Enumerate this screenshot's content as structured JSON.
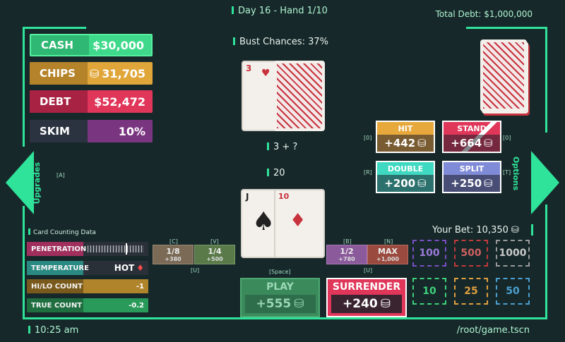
{
  "hud": {
    "day_hand": "Day 16  -  Hand 1/10",
    "total_debt": "Total Debt: $1,000,000",
    "clock": "10:25 am",
    "file_path": "/root/game.tscn"
  },
  "stats": {
    "cash": {
      "label": "CASH",
      "value": "$30,000",
      "color": "#3ed98a"
    },
    "chips": {
      "label": "CHIPS",
      "value": "31,705",
      "color": "#e0a63a"
    },
    "debt": {
      "label": "DEBT",
      "value": "$52,472",
      "color": "#e0365a"
    },
    "skim": {
      "label": "SKIM",
      "value": "10%",
      "color": "#8a3a8e"
    }
  },
  "table": {
    "bust_chances": "Bust Chances: 37%",
    "dealer_total": "3 + ?",
    "player_total": "20",
    "dealer_card": {
      "rank": "3",
      "suit": "♥"
    },
    "player_cards": [
      {
        "rank": "J",
        "suit": "♠"
      },
      {
        "rank": "10",
        "suit": "♦"
      }
    ]
  },
  "side": {
    "upgrades": "Upgrades",
    "upgrades_key": "[A]",
    "options": "Options",
    "options_key": "[T]"
  },
  "actions": {
    "hit": {
      "label": "HIT",
      "value": "+442",
      "key": "[0]",
      "color": "#e8a93c"
    },
    "stand": {
      "label": "STAND",
      "value": "+664",
      "key": "[0]",
      "color": "#e0365a"
    },
    "double": {
      "label": "DOUBLE",
      "value": "+200",
      "key": "[R]",
      "color": "#3fd8c0"
    },
    "split": {
      "label": "SPLIT",
      "value": "+250",
      "key": "[T]",
      "color": "#7f8bd6"
    }
  },
  "counting": {
    "title": "Card Counting Data",
    "penetration": {
      "label": "PENETRATION",
      "value": 0.68
    },
    "temperature": {
      "label": "TEMPERATURE",
      "value": "HOT"
    },
    "hilo": {
      "label": "HI/LO COUNT",
      "value": "-1"
    },
    "true_count": {
      "label": "TRUE COUNT",
      "value": "-0.2"
    }
  },
  "bet_fractions": [
    {
      "label": "1/8",
      "sub": "+380",
      "key": "[C]"
    },
    {
      "label": "1/4",
      "sub": "+500",
      "key": "[V]"
    },
    {
      "label": "1/2",
      "sub": "+780",
      "key": "[B]"
    },
    {
      "label": "MAX",
      "sub": "+1,000",
      "key": "[N]"
    }
  ],
  "fraction_keys": {
    "left": "[U]",
    "right": "[U]"
  },
  "play": {
    "label": "PLAY",
    "value": "+555",
    "key": "[Space]"
  },
  "surrender": {
    "label": "SURRENDER",
    "value": "+240"
  },
  "your_bet": "Your Bet: 10,350",
  "chip_buttons": [
    {
      "value": "100",
      "color": "#7a4fc4"
    },
    {
      "value": "500",
      "color": "#c03a3a"
    },
    {
      "value": "1000",
      "color": "#c9c9c9"
    },
    {
      "value": "10",
      "color": "#3fd17a"
    },
    {
      "value": "25",
      "color": "#e0a040"
    },
    {
      "value": "50",
      "color": "#4aa0d0"
    }
  ]
}
